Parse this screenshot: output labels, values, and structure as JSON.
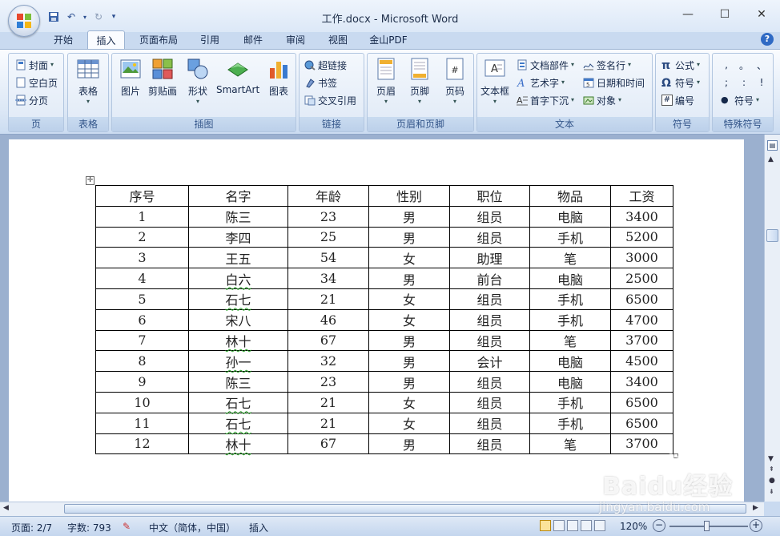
{
  "window": {
    "title": "工作.docx - Microsoft Word"
  },
  "tabs": [
    "开始",
    "插入",
    "页面布局",
    "引用",
    "邮件",
    "审阅",
    "视图",
    "金山PDF"
  ],
  "active_tab": "插入",
  "ribbon": {
    "page": {
      "label": "页",
      "cover": "封面",
      "blank": "空白页",
      "break": "分页"
    },
    "table": {
      "label": "表格",
      "table": "表格"
    },
    "illus": {
      "label": "插图",
      "picture": "图片",
      "clipart": "剪贴画",
      "shapes": "形状",
      "smartart": "SmartArt",
      "chart": "图表"
    },
    "links": {
      "label": "链接",
      "hyperlink": "超链接",
      "bookmark": "书签",
      "crossref": "交叉引用"
    },
    "hf": {
      "label": "页眉和页脚",
      "header": "页眉",
      "footer": "页脚",
      "pagenum": "页码"
    },
    "text": {
      "label": "文本",
      "textbox": "文本框",
      "parts": "文档部件",
      "wordart": "艺术字",
      "dropcap": "首字下沉",
      "signature": "签名行",
      "datetime": "日期和时间",
      "object": "对象"
    },
    "symbols": {
      "label": "符号",
      "formula": "公式",
      "symbol": "符号",
      "number": "编号",
      "pi": "π",
      "omega": "Ω",
      "hash": "#"
    },
    "special": {
      "label": "特殊符号",
      "symbol": "符号",
      "marks": [
        ",",
        "。",
        "、",
        ";",
        ":",
        "!"
      ]
    }
  },
  "table": {
    "headers": [
      "序号",
      "名字",
      "年龄",
      "性别",
      "职位",
      "物品",
      "工资"
    ],
    "rows": [
      [
        "1",
        "陈三",
        "23",
        "男",
        "组员",
        "电脑",
        "3400"
      ],
      [
        "2",
        "李四",
        "25",
        "男",
        "组员",
        "手机",
        "5200"
      ],
      [
        "3",
        "王五",
        "54",
        "女",
        "助理",
        "笔",
        "3000"
      ],
      [
        "4",
        "白六",
        "34",
        "男",
        "前台",
        "电脑",
        "2500"
      ],
      [
        "5",
        "石七",
        "21",
        "女",
        "组员",
        "手机",
        "6500"
      ],
      [
        "6",
        "宋八",
        "46",
        "女",
        "组员",
        "手机",
        "4700"
      ],
      [
        "7",
        "林十",
        "67",
        "男",
        "组员",
        "笔",
        "3700"
      ],
      [
        "8",
        "孙一",
        "32",
        "男",
        "会计",
        "电脑",
        "4500"
      ],
      [
        "9",
        "陈三",
        "23",
        "男",
        "组员",
        "电脑",
        "3400"
      ],
      [
        "10",
        "石七",
        "21",
        "女",
        "组员",
        "手机",
        "6500"
      ],
      [
        "11",
        "石七",
        "21",
        "女",
        "组员",
        "手机",
        "6500"
      ],
      [
        "12",
        "林十",
        "67",
        "男",
        "组员",
        "笔",
        "3700"
      ]
    ],
    "spellcheck_names": [
      "白六",
      "石七",
      "林十",
      "孙一"
    ]
  },
  "status": {
    "page": "页面: 2/7",
    "words": "字数: 793",
    "lang": "中文（简体，中国）",
    "mode": "插入",
    "zoom": "120%"
  },
  "watermark": {
    "brand": "Baidu经验",
    "url": "jingyan.baidu.com"
  },
  "colors": {
    "ribbon_bg": "#dde8f6",
    "doc_bg": "#9bb0cf",
    "accent": "#2f6ac4",
    "spell_underline": "#29a329"
  }
}
